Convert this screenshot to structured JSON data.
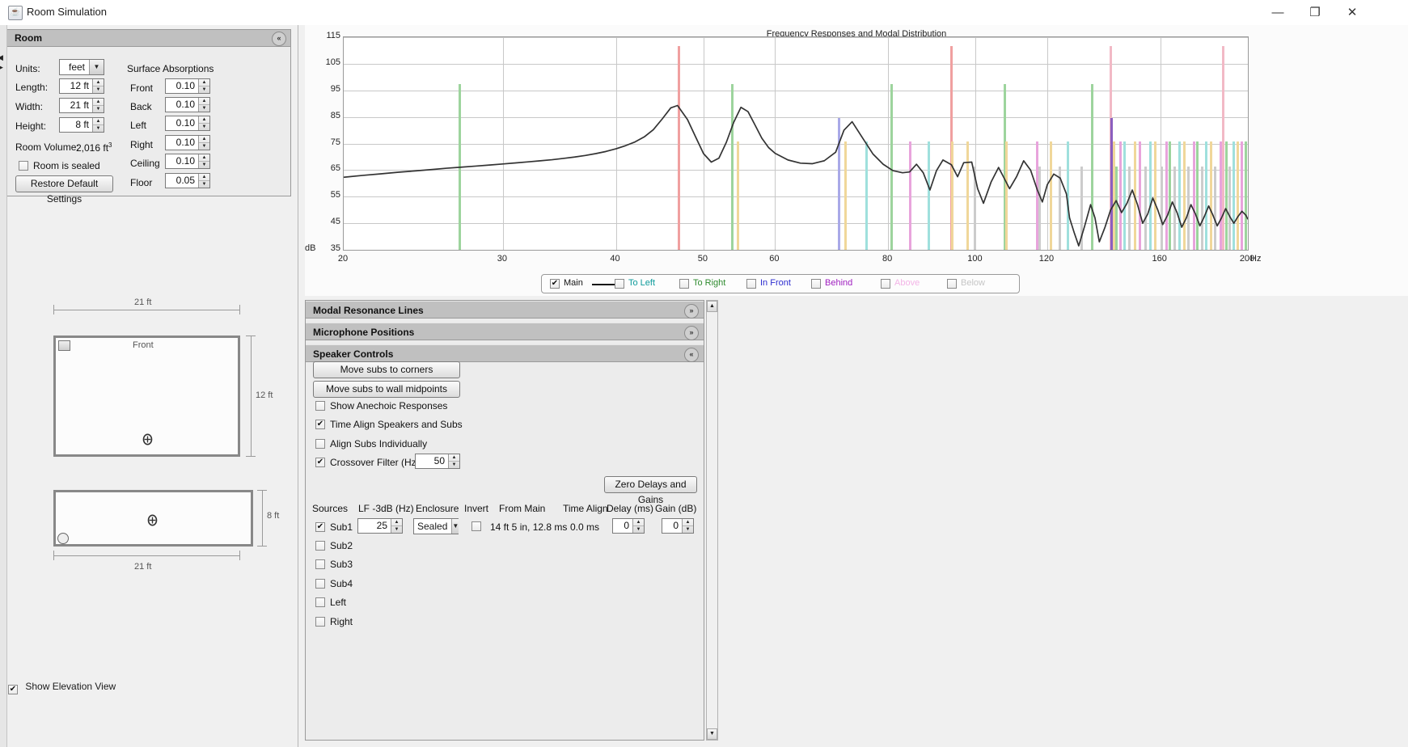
{
  "window": {
    "title": "Room Simulation",
    "icon": "java-coffee-icon",
    "minimize": "—",
    "maximize": "❐",
    "close": "✕"
  },
  "room_panel": {
    "header": "Room",
    "collapse_icon": "«",
    "units_label": "Units:",
    "units_value": "feet",
    "length_label": "Length:",
    "length_value": "12 ft",
    "width_label": "Width:",
    "width_value": "21 ft",
    "height_label": "Height:",
    "height_value": "8 ft",
    "volume_label": "Room Volume:",
    "volume_value": "2,016 ft",
    "volume_exponent": "3",
    "sealed_label": "Room is sealed",
    "sealed_checked": false,
    "restore_button": "Restore Default Settings",
    "absorptions_title": "Surface Absorptions",
    "absorptions": [
      {
        "label": "Front",
        "value": "0.10"
      },
      {
        "label": "Back",
        "value": "0.10"
      },
      {
        "label": "Left",
        "value": "0.10"
      },
      {
        "label": "Right",
        "value": "0.10"
      },
      {
        "label": "Ceiling",
        "value": "0.10"
      },
      {
        "label": "Floor",
        "value": "0.05"
      }
    ]
  },
  "diagrams": {
    "plan_width_dim": "21 ft",
    "plan_depth_dim": "12 ft",
    "plan_front_label": "Front",
    "elev_width_dim": "21 ft",
    "elev_height_dim": "8 ft",
    "show_elevation_label": "Show Elevation View",
    "show_elevation_checked": true
  },
  "chart_data": {
    "type": "line",
    "title": "Frequency Responses and Modal Distribution",
    "xlabel": "Hz",
    "ylabel": "dB",
    "xscale": "log",
    "xlim": [
      20,
      200
    ],
    "ylim": [
      35,
      115
    ],
    "yticks": [
      35,
      45,
      55,
      65,
      75,
      85,
      95,
      105,
      115
    ],
    "ytick_labels": [
      "35",
      "45",
      "55",
      "65",
      "75",
      "85",
      "95",
      "105",
      "115"
    ],
    "y_axis_prefix": "dB",
    "xticks": [
      20,
      30,
      40,
      50,
      60,
      80,
      100,
      120,
      160,
      200
    ],
    "xtick_labels": [
      "20",
      "30",
      "40",
      "50",
      "60",
      "80",
      "100",
      "120",
      "160",
      "200"
    ],
    "x_axis_suffix": "Hz",
    "grid": true,
    "legend_position": "below",
    "series": [
      {
        "name": "Main",
        "color": "#333333",
        "x": [
          20,
          21,
          22,
          23,
          24,
          25,
          26,
          27,
          28,
          29,
          30,
          31,
          32,
          33,
          34,
          35,
          36,
          37,
          38,
          39,
          40,
          41,
          42,
          43,
          44,
          45,
          46,
          46.8,
          48,
          49,
          50,
          51,
          52,
          53,
          54,
          55,
          56,
          57,
          58,
          59,
          60,
          62,
          64,
          66,
          68,
          70,
          71.5,
          73,
          75,
          77,
          79,
          81,
          83,
          84.5,
          86,
          87.5,
          89,
          90.5,
          92,
          94,
          95.5,
          97,
          99,
          100.5,
          102,
          104,
          106,
          107.5,
          109,
          111,
          113,
          115,
          117,
          118.5,
          120,
          122,
          124,
          126,
          127,
          128.5,
          130,
          132,
          134,
          135.5,
          137,
          139,
          141,
          143,
          145,
          147,
          149,
          151,
          153,
          155,
          157,
          159,
          161,
          163,
          165,
          167,
          169,
          171,
          173,
          175,
          177,
          179,
          181,
          183,
          185,
          187,
          189,
          191,
          193,
          195,
          197,
          199,
          200
        ],
        "y": [
          62.3,
          63.0,
          63.6,
          64.2,
          64.7,
          65.2,
          65.7,
          66.1,
          66.5,
          66.9,
          67.3,
          67.7,
          68.1,
          68.5,
          68.9,
          69.4,
          69.9,
          70.5,
          71.2,
          72.0,
          73.0,
          74.2,
          75.6,
          77.5,
          80.2,
          84.2,
          88.4,
          89.3,
          84.0,
          77.5,
          71.2,
          68.0,
          69.5,
          75.5,
          83.0,
          88.6,
          87.0,
          82.0,
          77.0,
          73.5,
          71.3,
          68.8,
          67.6,
          67.4,
          68.5,
          71.7,
          80.0,
          83.2,
          77.0,
          71.0,
          67.2,
          64.8,
          64.0,
          64.3,
          67.2,
          64.0,
          57.5,
          64.8,
          68.8,
          67.0,
          62.5,
          67.8,
          68.0,
          58.0,
          52.5,
          60.5,
          66.0,
          62.0,
          58.0,
          62.6,
          68.5,
          65.0,
          57.5,
          53.0,
          59.5,
          63.5,
          62.0,
          56.0,
          47.0,
          41.5,
          36.5,
          44.0,
          52.0,
          47.0,
          38.0,
          43.5,
          50.0,
          53.5,
          49.0,
          52.5,
          57.5,
          52.0,
          45.0,
          48.5,
          54.5,
          50.0,
          44.5,
          48.0,
          53.0,
          49.0,
          43.5,
          47.0,
          52.0,
          48.5,
          44.0,
          47.5,
          51.5,
          48.0,
          44.0,
          47.0,
          50.5,
          47.5,
          45.0,
          47.5,
          49.5,
          48.0,
          46.5,
          45.5
        ]
      }
    ],
    "modal_lines_note": "Vertical colored bars mark room modal resonances; bar color encodes axis group, height encodes relative strength.",
    "modal_lines": [
      {
        "hz": 26.9,
        "height": 78,
        "color": "#9dd49d"
      },
      {
        "hz": 47.0,
        "height": 96,
        "color": "#f0a0a0"
      },
      {
        "hz": 53.8,
        "height": 78,
        "color": "#9dd49d"
      },
      {
        "hz": 54.6,
        "height": 51,
        "color": "#f0d79a"
      },
      {
        "hz": 70.6,
        "height": 62,
        "color": "#a9a9e8"
      },
      {
        "hz": 71.8,
        "height": 51,
        "color": "#f0d79a"
      },
      {
        "hz": 75.8,
        "height": 51,
        "color": "#9fe0dd"
      },
      {
        "hz": 80.7,
        "height": 78,
        "color": "#9dd49d"
      },
      {
        "hz": 84.6,
        "height": 51,
        "color": "#e8a4dc"
      },
      {
        "hz": 88.7,
        "height": 51,
        "color": "#9fe0dd"
      },
      {
        "hz": 94.0,
        "height": 96,
        "color": "#f0a0a0"
      },
      {
        "hz": 94.3,
        "height": 51,
        "color": "#f0d79a"
      },
      {
        "hz": 98.0,
        "height": 51,
        "color": "#f0d79a"
      },
      {
        "hz": 99.8,
        "height": 39,
        "color": "#cccccc"
      },
      {
        "hz": 107.6,
        "height": 78,
        "color": "#9dd49d"
      },
      {
        "hz": 108.2,
        "height": 51,
        "color": "#f0d79a"
      },
      {
        "hz": 117.0,
        "height": 51,
        "color": "#e8a4dc"
      },
      {
        "hz": 117.8,
        "height": 39,
        "color": "#cccccc"
      },
      {
        "hz": 121.0,
        "height": 51,
        "color": "#f0d79a"
      },
      {
        "hz": 124.0,
        "height": 39,
        "color": "#cccccc"
      },
      {
        "hz": 126.5,
        "height": 51,
        "color": "#9fe0dd"
      },
      {
        "hz": 131.0,
        "height": 39,
        "color": "#cccccc"
      },
      {
        "hz": 134.5,
        "height": 78,
        "color": "#9dd49d"
      },
      {
        "hz": 141.0,
        "height": 96,
        "color": "#f2b9c6"
      },
      {
        "hz": 141.3,
        "height": 62,
        "color": "#8b5fbf"
      },
      {
        "hz": 142.2,
        "height": 51,
        "color": "#f0d79a"
      },
      {
        "hz": 143.0,
        "height": 39,
        "color": "#9dd49d"
      },
      {
        "hz": 144.5,
        "height": 51,
        "color": "#e8a4dc"
      },
      {
        "hz": 146.0,
        "height": 51,
        "color": "#9fe0dd"
      },
      {
        "hz": 148.0,
        "height": 39,
        "color": "#cccccc"
      },
      {
        "hz": 150.0,
        "height": 51,
        "color": "#f0d79a"
      },
      {
        "hz": 152.0,
        "height": 51,
        "color": "#e8a4dc"
      },
      {
        "hz": 154.0,
        "height": 39,
        "color": "#cccccc"
      },
      {
        "hz": 156.0,
        "height": 51,
        "color": "#9fe0dd"
      },
      {
        "hz": 158.0,
        "height": 51,
        "color": "#f0d79a"
      },
      {
        "hz": 160.5,
        "height": 39,
        "color": "#cccccc"
      },
      {
        "hz": 162.5,
        "height": 51,
        "color": "#e8a4dc"
      },
      {
        "hz": 164.0,
        "height": 51,
        "color": "#9dd49d"
      },
      {
        "hz": 166.0,
        "height": 39,
        "color": "#cccccc"
      },
      {
        "hz": 168.0,
        "height": 51,
        "color": "#9fe0dd"
      },
      {
        "hz": 170.0,
        "height": 51,
        "color": "#f0d79a"
      },
      {
        "hz": 172.0,
        "height": 39,
        "color": "#cccccc"
      },
      {
        "hz": 174.5,
        "height": 51,
        "color": "#e8a4dc"
      },
      {
        "hz": 176.0,
        "height": 51,
        "color": "#9dd49d"
      },
      {
        "hz": 178.0,
        "height": 39,
        "color": "#cccccc"
      },
      {
        "hz": 180.0,
        "height": 51,
        "color": "#9fe0dd"
      },
      {
        "hz": 182.0,
        "height": 51,
        "color": "#f0d79a"
      },
      {
        "hz": 184.0,
        "height": 39,
        "color": "#cccccc"
      },
      {
        "hz": 186.5,
        "height": 51,
        "color": "#e8a4dc"
      },
      {
        "hz": 188.0,
        "height": 96,
        "color": "#f2b9c6"
      },
      {
        "hz": 189.5,
        "height": 51,
        "color": "#9dd49d"
      },
      {
        "hz": 191.0,
        "height": 39,
        "color": "#cccccc"
      },
      {
        "hz": 193.0,
        "height": 51,
        "color": "#9fe0dd"
      },
      {
        "hz": 195.0,
        "height": 51,
        "color": "#f0d79a"
      },
      {
        "hz": 197.0,
        "height": 51,
        "color": "#e8a4dc"
      },
      {
        "hz": 199.0,
        "height": 51,
        "color": "#9dd49d"
      }
    ]
  },
  "legend": [
    {
      "label": "Main",
      "checked": true,
      "color": "#111111",
      "enabled": true,
      "has_line": true
    },
    {
      "label": "To Left",
      "checked": false,
      "color": "#0d9b9b",
      "enabled": true,
      "has_line": false
    },
    {
      "label": "To Right",
      "checked": false,
      "color": "#2e8b2e",
      "enabled": true,
      "has_line": false
    },
    {
      "label": "In Front",
      "checked": false,
      "color": "#2b2bcf",
      "enabled": true,
      "has_line": false
    },
    {
      "label": "Behind",
      "checked": false,
      "color": "#a020c0",
      "enabled": true,
      "has_line": false
    },
    {
      "label": "Above",
      "checked": false,
      "color": "#ee8ddb",
      "enabled": false,
      "has_line": false
    },
    {
      "label": "Below",
      "checked": false,
      "color": "#a8a8a8",
      "enabled": false,
      "has_line": false
    }
  ],
  "accordion": {
    "modal_resonance_lines": {
      "title": "Modal Resonance Lines",
      "expanded": false,
      "chevron": "»"
    },
    "microphone_positions": {
      "title": "Microphone Positions",
      "expanded": false,
      "chevron": "»"
    },
    "speaker_controls": {
      "title": "Speaker Controls",
      "expanded": true,
      "chevron": "«"
    }
  },
  "speaker_controls": {
    "move_corners_button": "Move subs to corners",
    "move_midpoints_button": "Move subs to wall midpoints",
    "show_anechoic_label": "Show Anechoic Responses",
    "show_anechoic_checked": false,
    "time_align_label": "Time Align Speakers and Subs",
    "time_align_checked": true,
    "align_individually_label": "Align Subs Individually",
    "align_individually_checked": false,
    "crossover_label": "Crossover Filter (Hz)",
    "crossover_checked": true,
    "crossover_value": "50",
    "zero_delays_button": "Zero Delays and Gains",
    "table": {
      "headers": [
        "Sources",
        "LF -3dB (Hz)",
        "Enclosure",
        "Invert",
        "From Main",
        "Time Align",
        "Delay (ms)",
        "Gain (dB)"
      ],
      "rows": [
        {
          "name": "Sub1",
          "checked": true,
          "lf_3db": "25",
          "enclosure": "Sealed",
          "invert": false,
          "from_main": "14 ft 5 in, 12.8 ms",
          "time_align": "0.0 ms",
          "delay": "0",
          "gain": "0"
        },
        {
          "name": "Sub2",
          "checked": false
        },
        {
          "name": "Sub3",
          "checked": false
        },
        {
          "name": "Sub4",
          "checked": false
        },
        {
          "name": "Left",
          "checked": false
        },
        {
          "name": "Right",
          "checked": false
        }
      ]
    }
  },
  "scrollbar": {
    "up_arrow": "▲",
    "down_arrow": "▼"
  },
  "divider": {
    "left_arrow": "◀",
    "right_arrow": "▶"
  }
}
